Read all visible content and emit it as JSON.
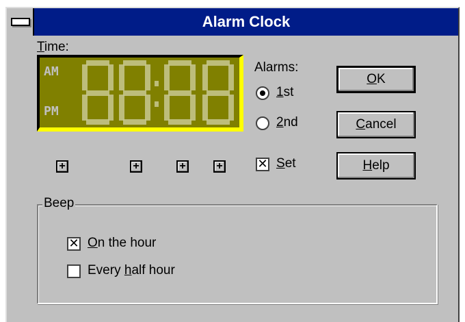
{
  "window": {
    "title": "Alarm Clock"
  },
  "time": {
    "label_prefix": "",
    "label_underline": "T",
    "label_rest": "ime:",
    "am": "AM",
    "pm": "PM",
    "display": "88:88"
  },
  "alarms": {
    "label": "Alarms:",
    "first": {
      "u": "1",
      "rest": "st",
      "selected": true
    },
    "second": {
      "u": "2",
      "rest": "nd",
      "selected": false
    },
    "set": {
      "u": "S",
      "rest": "et",
      "checked": true
    }
  },
  "buttons": {
    "ok": {
      "u": "O",
      "rest": "K"
    },
    "cancel": {
      "u": "C",
      "rest": "ancel"
    },
    "help": {
      "u": "H",
      "rest": "elp"
    }
  },
  "beep": {
    "label": "Beep",
    "on_hour": {
      "u": "O",
      "rest": "n the hour",
      "checked": true
    },
    "half_hour": {
      "pre": "Every ",
      "u": "h",
      "rest": "alf hour",
      "checked": false
    }
  },
  "spinner_symbol": "+",
  "check_mark": "✕"
}
